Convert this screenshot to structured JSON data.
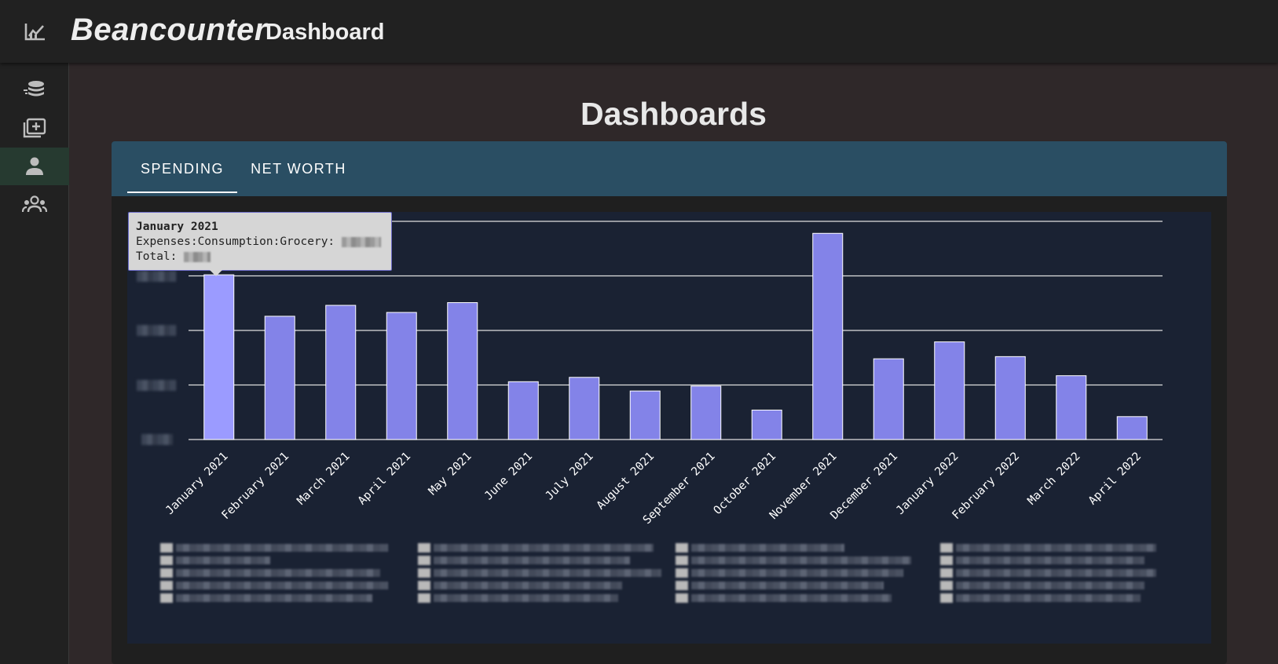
{
  "app": {
    "brand": "Beancounter",
    "page_title": "Dashboard"
  },
  "sidebar": {
    "items": [
      {
        "name": "coins-stack-icon",
        "active": false
      },
      {
        "name": "add-folder-icon",
        "active": false
      },
      {
        "name": "person-icon",
        "active": true
      },
      {
        "name": "group-icon",
        "active": false
      }
    ]
  },
  "main": {
    "heading": "Dashboards",
    "tabs": [
      {
        "label": "SPENDING",
        "active": true
      },
      {
        "label": "NET WORTH",
        "active": false
      }
    ]
  },
  "tooltip": {
    "title": "January 2021",
    "line1_label": "Expenses:Consumption:Grocery:",
    "line2_label": "Total:"
  },
  "colors": {
    "bar": "#8383e8",
    "bar_highlight": "#9b9bff",
    "tabs_bg": "#2a4e63",
    "chart_bg": "#1a2233"
  },
  "chart_data": {
    "type": "bar",
    "categories": [
      "January 2021",
      "February 2021",
      "March 2021",
      "April 2021",
      "May 2021",
      "June 2021",
      "July 2021",
      "August 2021",
      "September 2021",
      "October 2021",
      "November 2021",
      "December 2021",
      "January 2022",
      "February 2022",
      "March 2022",
      "April 2022"
    ],
    "series": [
      {
        "values": [
          3.02,
          2.26,
          2.46,
          2.33,
          2.51,
          1.06,
          1.14,
          0.89,
          0.98,
          0.54,
          3.78,
          1.48,
          1.79,
          1.52,
          1.17,
          0.42
        ]
      }
    ],
    "ylim": [
      0,
      4
    ],
    "ytick_count": 5,
    "grid": true,
    "highlighted_index": 0,
    "title": "",
    "xlabel": "",
    "ylabel": ""
  }
}
